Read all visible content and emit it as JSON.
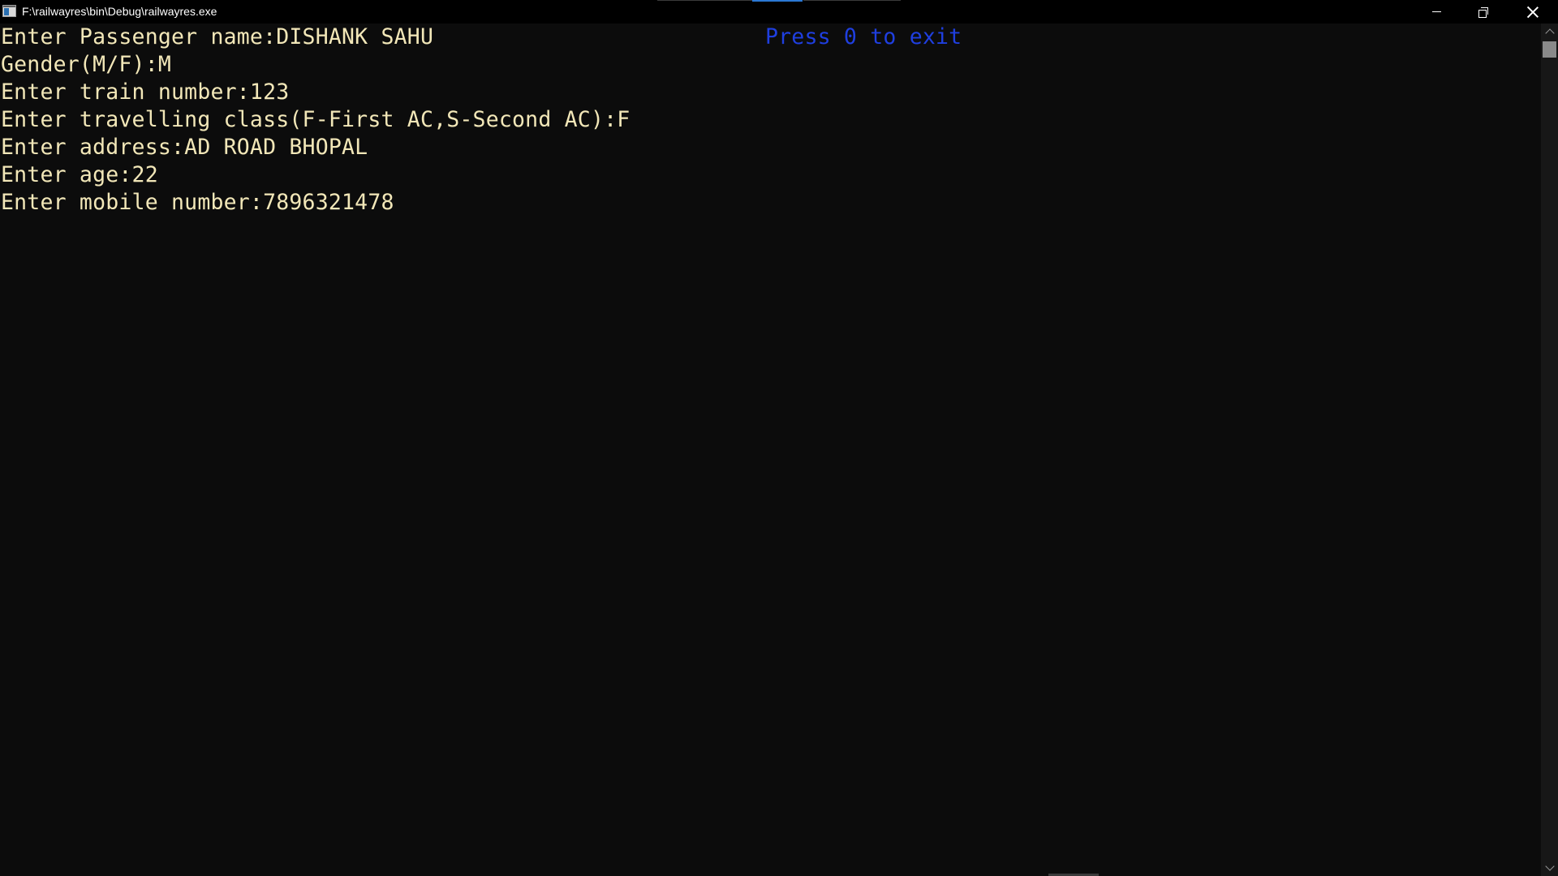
{
  "window": {
    "title": "F:\\railwayres\\bin\\Debug\\railwayres.exe",
    "icon": "console-app-icon",
    "controls": {
      "minimize_icon": "minimize-icon",
      "maximize_icon": "restore-icon",
      "close_icon": "close-icon"
    }
  },
  "console": {
    "lines": [
      "Enter Passenger name:DISHANK SAHU",
      "Gender(M/F):M",
      "Enter train number:123",
      "Enter travelling class(F-First AC,S-Second AC):F",
      "Enter address:AD ROAD BHOPAL",
      "Enter age:22",
      "Enter mobile number:7896321478"
    ],
    "exit_hint": "Press 0 to exit",
    "colors": {
      "background": "#0c0c0c",
      "text": "#f2e7b8",
      "exit_hint": "#1f3fe0"
    }
  },
  "scrollbar": {
    "up_icon": "chevron-up-icon",
    "down_icon": "chevron-down-icon"
  }
}
